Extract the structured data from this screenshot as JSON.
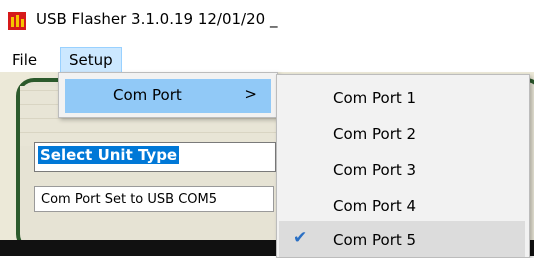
{
  "window": {
    "title": "USB Flasher 3.1.0.19  12/01/20 _"
  },
  "menubar": {
    "file_label": "File",
    "setup_label": "Setup"
  },
  "setup_menu": {
    "com_port_label": "Com Port",
    "submenu_arrow": ">"
  },
  "com_port_menu": {
    "items": [
      {
        "label": "Com Port 1",
        "checked": false
      },
      {
        "label": "Com Port 2",
        "checked": false
      },
      {
        "label": "Com Port 3",
        "checked": false
      },
      {
        "label": "Com Port 4",
        "checked": false
      },
      {
        "label": "Com Port 5",
        "checked": true
      }
    ],
    "check_glyph": "✔"
  },
  "main": {
    "unit_type_value": "Select Unit Type",
    "status_text": "Com Port Set to USB COM5"
  },
  "colors": {
    "menu_highlight": "#91c9f7",
    "selection_blue": "#0078d7",
    "frame_green": "#2c5a2c"
  }
}
